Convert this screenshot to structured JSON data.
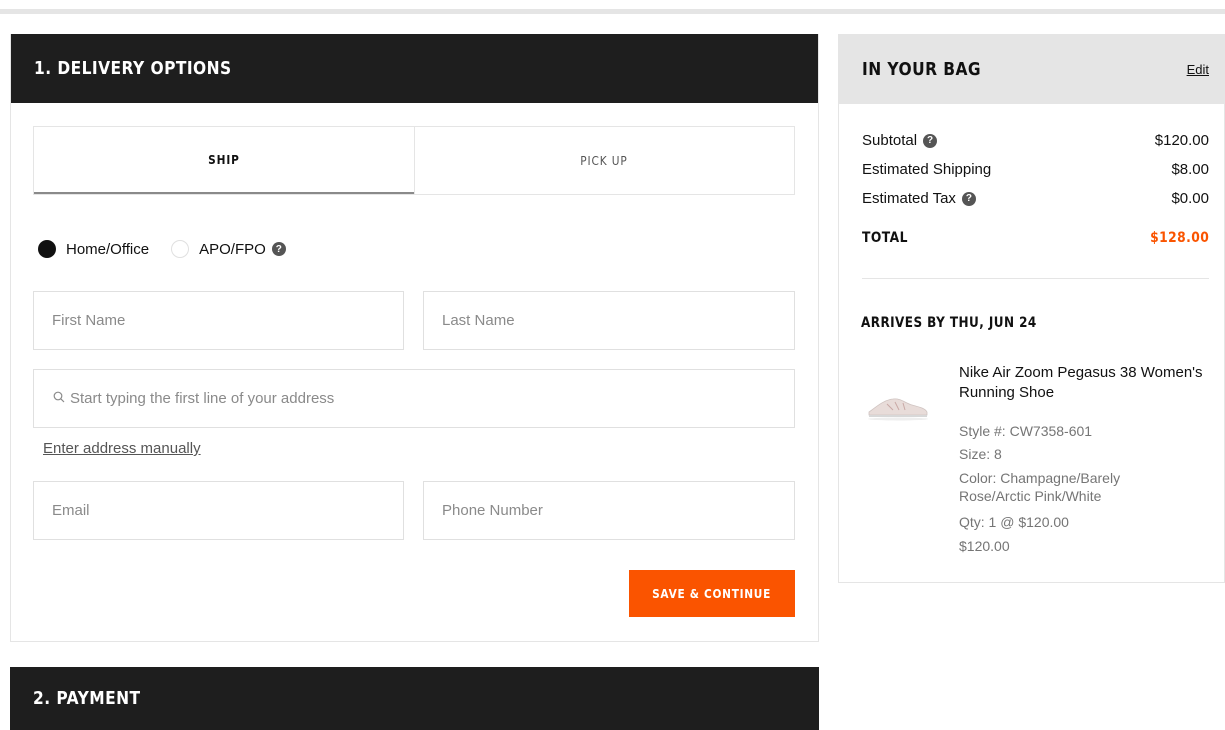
{
  "delivery": {
    "title": "1. DELIVERY OPTIONS",
    "tabs": [
      {
        "label": "SHIP",
        "active": true
      },
      {
        "label": "PICK UP",
        "active": false
      }
    ],
    "address_type": {
      "options": [
        {
          "label": "Home/Office",
          "selected": true
        },
        {
          "label": "APO/FPO",
          "selected": false
        }
      ],
      "help_icon": "?"
    },
    "fields": {
      "first_name": {
        "placeholder": "First Name",
        "value": ""
      },
      "last_name": {
        "placeholder": "Last Name",
        "value": ""
      },
      "address": {
        "placeholder": "Start typing the first line of your address",
        "value": ""
      },
      "email": {
        "placeholder": "Email",
        "value": ""
      },
      "phone": {
        "placeholder": "Phone Number",
        "value": ""
      }
    },
    "manual_link": "Enter address manually",
    "save_button": "SAVE & CONTINUE"
  },
  "payment": {
    "title": "2. PAYMENT"
  },
  "bag": {
    "title": "IN YOUR BAG",
    "edit_label": "Edit",
    "summary": [
      {
        "label": "Subtotal",
        "value": "$120.00",
        "help": true
      },
      {
        "label": "Estimated Shipping",
        "value": "$8.00",
        "help": false
      },
      {
        "label": "Estimated Tax",
        "value": "$0.00",
        "help": true
      }
    ],
    "total_label": "TOTAL",
    "total_value": "$128.00",
    "arrives": "ARRIVES BY THU, JUN 24",
    "product": {
      "name": "Nike Air Zoom Pegasus 38 Women's Running Shoe",
      "style": "Style #: CW7358-601",
      "size": "Size: 8",
      "color": "Color: Champagne/Barely Rose/Arctic Pink/White",
      "qty": "Qty: 1 @ $120.00",
      "price": "$120.00"
    }
  },
  "colors": {
    "accent": "#fa5400",
    "header_dark": "#1e1e1e",
    "header_light": "#e5e5e5"
  }
}
